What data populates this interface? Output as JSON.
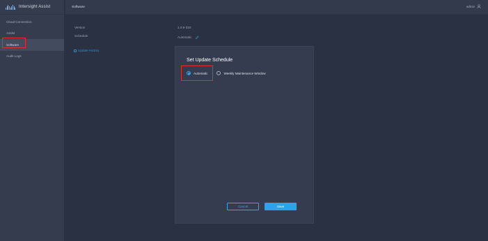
{
  "app": {
    "brand_name": "Intersight Assist",
    "logo_icon": "cisco-logo-icon"
  },
  "sidebar": {
    "items": [
      {
        "label": "Cloud Connection",
        "active": false
      },
      {
        "label": "Assist",
        "active": false
      },
      {
        "label": "Software",
        "active": true
      },
      {
        "label": "Audit Logs",
        "active": false
      }
    ]
  },
  "header": {
    "title": "Software",
    "user_label": "admin",
    "user_icon": "user-icon"
  },
  "software": {
    "version_label": "Version",
    "version_value": "1.0.9-319",
    "schedule_label": "Schedule",
    "schedule_value": "Automatic",
    "edit_icon": "pencil-icon",
    "update_history_label": "Update History",
    "update_history_icon": "history-icon"
  },
  "modal": {
    "title": "Set Update Schedule",
    "options": [
      {
        "label": "Automatic",
        "selected": true
      },
      {
        "label": "Weekly Maintenance Window",
        "selected": false
      }
    ],
    "cancel_label": "Cancel",
    "save_label": "Save"
  },
  "colors": {
    "accent": "#2ea3e6",
    "highlight_box": "#e0302a",
    "background": "#2a3142",
    "sidebar": "#353c4e",
    "modal": "#353c50"
  }
}
